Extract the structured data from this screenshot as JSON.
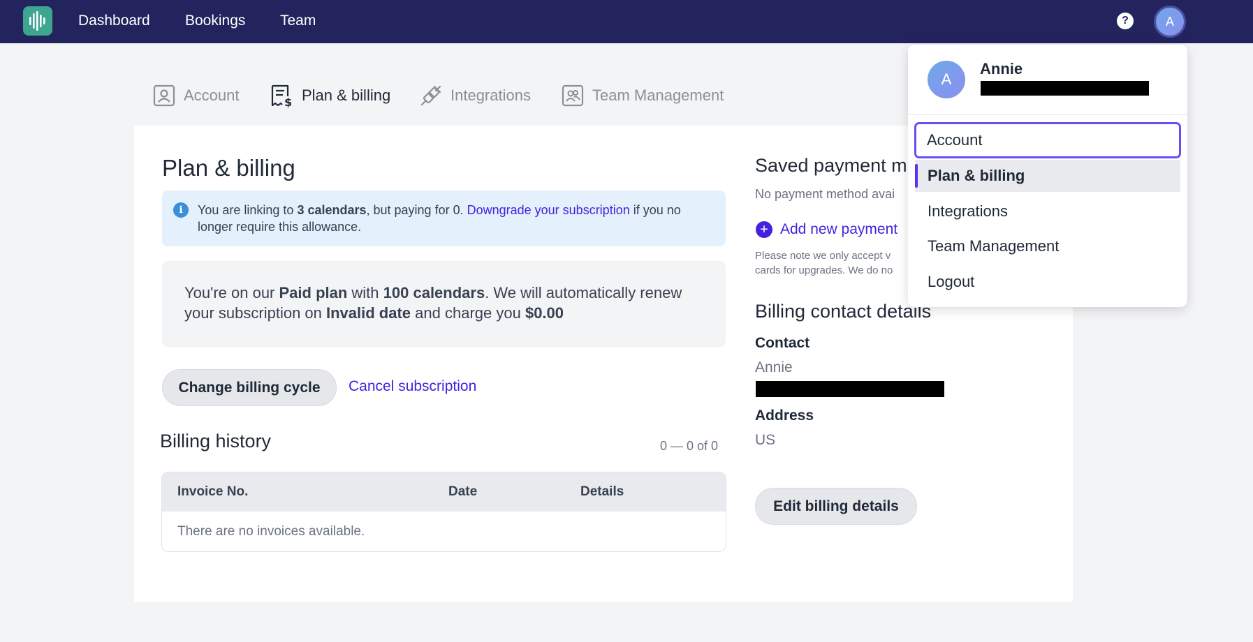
{
  "topbar": {
    "logo_icon": "waveform-logo-icon",
    "nav": [
      "Dashboard",
      "Bookings",
      "Team"
    ],
    "help_label": "?",
    "avatar_initial": "A"
  },
  "settings_tabs": [
    {
      "label": "Account",
      "icon": "user-card-icon",
      "active": false
    },
    {
      "label": "Plan & billing",
      "icon": "receipt-dollar-icon",
      "active": true
    },
    {
      "label": "Integrations",
      "icon": "plug-icon",
      "active": false
    },
    {
      "label": "Team Management",
      "icon": "team-card-icon",
      "active": false
    }
  ],
  "main": {
    "title": "Plan & billing",
    "info": {
      "icon": "info-icon",
      "glyph": "i",
      "part1": "You are linking to ",
      "bold1": "3 calendars",
      "part2": ", but paying for 0. ",
      "link": "Downgrade your subscription",
      "part3": " if you no longer require this allowance."
    },
    "plan": {
      "t1": "You're on our ",
      "b1": "Paid plan",
      "t2": " with ",
      "b2": "100 calendars",
      "t3": ". We will automatically renew your subscription on ",
      "b3": "Invalid date",
      "t4": " and charge you ",
      "b4": "$0.00"
    },
    "change_billing_cycle": "Change billing cycle",
    "cancel_subscription": "Cancel subscription",
    "billing_history": {
      "title": "Billing history",
      "pagination": "0 — 0 of 0",
      "columns": [
        "Invoice No.",
        "Date",
        "Details"
      ],
      "empty": "There are no invoices available."
    }
  },
  "right": {
    "saved_payment_title": "Saved payment m",
    "no_payment": "No payment method avai",
    "add_payment": "Add new payment",
    "add_payment_icon": "plus-circle-icon",
    "note_line1": "Please note we only accept v",
    "note_line2": "cards for upgrades. We do no",
    "billing_contact_title": "Billing contact details",
    "contact_label": "Contact",
    "contact_name": "Annie",
    "address_label": "Address",
    "address_value": "US",
    "edit_billing": "Edit billing details"
  },
  "dropdown": {
    "avatar_initial": "A",
    "name": "Annie",
    "items": [
      "Account",
      "Plan & billing",
      "Integrations",
      "Team Management",
      "Logout"
    ]
  },
  "colors": {
    "topbar": "#23245e",
    "accent": "#4422dd",
    "logo": "#3ea58f"
  }
}
